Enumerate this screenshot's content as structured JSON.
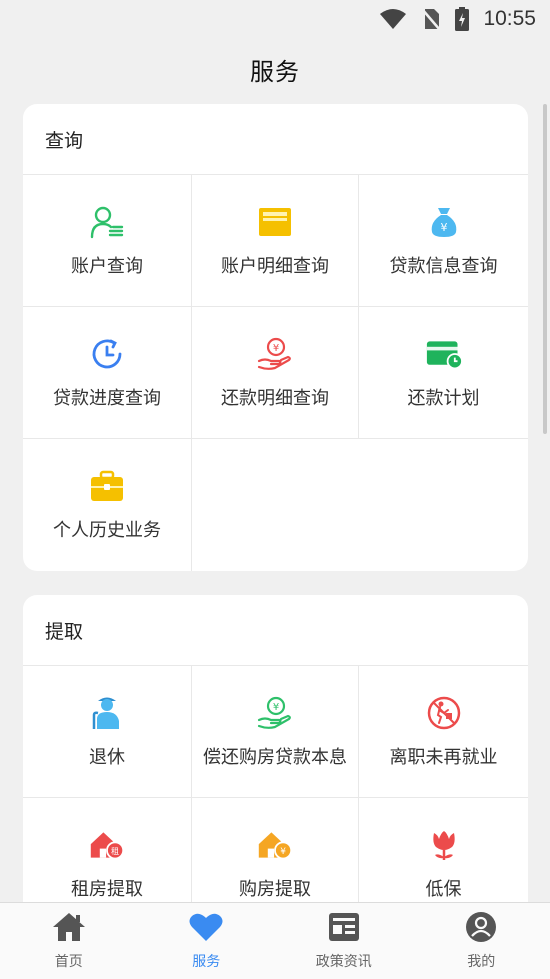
{
  "status_bar": {
    "time": "10:55"
  },
  "header": {
    "title": "服务"
  },
  "sections": [
    {
      "title": "查询",
      "items": [
        {
          "label": "账户查询",
          "icon": "account-user-icon",
          "color": "#2ec06a"
        },
        {
          "label": "账户明细查询",
          "icon": "account-detail-icon",
          "color": "#f5c000"
        },
        {
          "label": "贷款信息查询",
          "icon": "money-bag-icon",
          "color": "#4db8f0"
        },
        {
          "label": "贷款进度查询",
          "icon": "progress-clock-icon",
          "color": "#3a7ff0"
        },
        {
          "label": "还款明细查询",
          "icon": "hand-coin-icon",
          "color": "#ec4b4b"
        },
        {
          "label": "还款计划",
          "icon": "card-clock-icon",
          "color": "#1fb35c"
        },
        {
          "label": "个人历史业务",
          "icon": "briefcase-icon",
          "color": "#f5c000"
        }
      ]
    },
    {
      "title": "提取",
      "items": [
        {
          "label": "退休",
          "icon": "elderly-icon",
          "color": "#4db8f0"
        },
        {
          "label": "偿还购房贷款本息",
          "icon": "hand-coin-icon",
          "color": "#2ec06a"
        },
        {
          "label": "离职未再就业",
          "icon": "no-walking-icon",
          "color": "#ec4b4b"
        },
        {
          "label": "租房提取",
          "icon": "rent-house-icon",
          "color": "#ec4b4b"
        },
        {
          "label": "购房提取",
          "icon": "buy-house-icon",
          "color": "#f5a623"
        },
        {
          "label": "低保",
          "icon": "flower-icon",
          "color": "#ec4b4b"
        }
      ]
    }
  ],
  "bottom_nav": [
    {
      "label": "首页",
      "icon": "home-icon",
      "active": false
    },
    {
      "label": "服务",
      "icon": "heart-icon",
      "active": true
    },
    {
      "label": "政策资讯",
      "icon": "news-icon",
      "active": false
    },
    {
      "label": "我的",
      "icon": "profile-icon",
      "active": false
    }
  ],
  "accent_color": "#3a8bf1"
}
